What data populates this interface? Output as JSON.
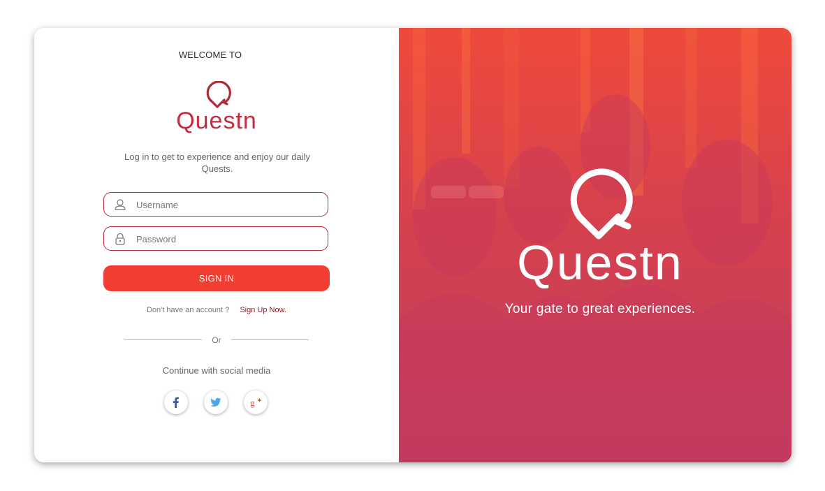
{
  "login": {
    "welcome": "WELCOME TO",
    "brand": "Questn",
    "tagline": "Log in to get to experience and enjoy our daily Quests.",
    "username_placeholder": "Username",
    "password_placeholder": "Password",
    "signin_label": "SIGN IN",
    "no_account_text": "Don't have an account ?",
    "signup_link": "Sign Up Now.",
    "or_text": "Or",
    "continue_text": "Continue with social media",
    "social": [
      {
        "name": "facebook",
        "icon": "facebook-icon"
      },
      {
        "name": "twitter",
        "icon": "twitter-icon"
      },
      {
        "name": "google-plus",
        "icon": "google-plus-icon"
      }
    ]
  },
  "hero": {
    "brand": "Questn",
    "tagline": "Your gate to great experiences."
  },
  "colors": {
    "brand": "#c72a3c",
    "button": "#f23d33",
    "link": "#8e1f30",
    "field_border": "#b8263a",
    "hero_overlay": "#d2404c"
  }
}
